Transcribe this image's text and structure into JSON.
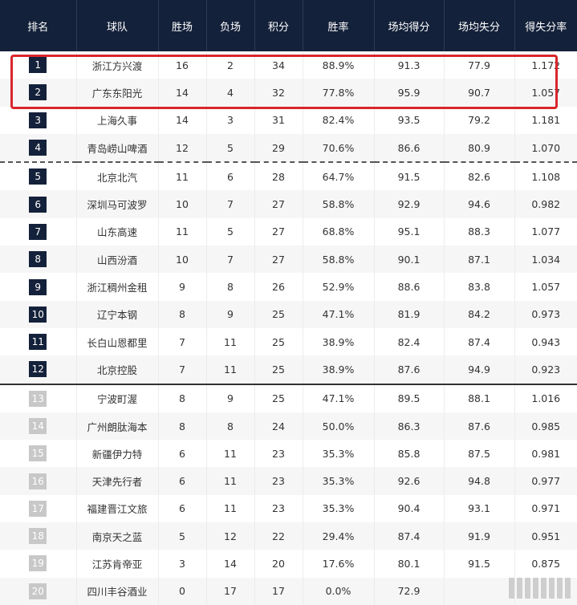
{
  "headers": [
    "排名",
    "球队",
    "胜场",
    "负场",
    "积分",
    "胜率",
    "场均得分",
    "场均失分",
    "得失分率"
  ],
  "rows": [
    {
      "rank": "1",
      "team": "浙江方兴渡",
      "wins": "16",
      "losses": "2",
      "points": "34",
      "win_pct": "88.9%",
      "ppg": "91.3",
      "opp_ppg": "77.9",
      "ratio": "1.172"
    },
    {
      "rank": "2",
      "team": "广东东阳光",
      "wins": "14",
      "losses": "4",
      "points": "32",
      "win_pct": "77.8%",
      "ppg": "95.9",
      "opp_ppg": "90.7",
      "ratio": "1.057"
    },
    {
      "rank": "3",
      "team": "上海久事",
      "wins": "14",
      "losses": "3",
      "points": "31",
      "win_pct": "82.4%",
      "ppg": "93.5",
      "opp_ppg": "79.2",
      "ratio": "1.181"
    },
    {
      "rank": "4",
      "team": "青岛崂山啤酒",
      "wins": "12",
      "losses": "5",
      "points": "29",
      "win_pct": "70.6%",
      "ppg": "86.6",
      "opp_ppg": "80.9",
      "ratio": "1.070"
    },
    {
      "rank": "5",
      "team": "北京北汽",
      "wins": "11",
      "losses": "6",
      "points": "28",
      "win_pct": "64.7%",
      "ppg": "91.5",
      "opp_ppg": "82.6",
      "ratio": "1.108"
    },
    {
      "rank": "6",
      "team": "深圳马可波罗",
      "wins": "10",
      "losses": "7",
      "points": "27",
      "win_pct": "58.8%",
      "ppg": "92.9",
      "opp_ppg": "94.6",
      "ratio": "0.982"
    },
    {
      "rank": "7",
      "team": "山东高速",
      "wins": "11",
      "losses": "5",
      "points": "27",
      "win_pct": "68.8%",
      "ppg": "95.1",
      "opp_ppg": "88.3",
      "ratio": "1.077"
    },
    {
      "rank": "8",
      "team": "山西汾酒",
      "wins": "10",
      "losses": "7",
      "points": "27",
      "win_pct": "58.8%",
      "ppg": "90.1",
      "opp_ppg": "87.1",
      "ratio": "1.034"
    },
    {
      "rank": "9",
      "team": "浙江稠州金租",
      "wins": "9",
      "losses": "8",
      "points": "26",
      "win_pct": "52.9%",
      "ppg": "88.6",
      "opp_ppg": "83.8",
      "ratio": "1.057"
    },
    {
      "rank": "10",
      "team": "辽宁本钢",
      "wins": "8",
      "losses": "9",
      "points": "25",
      "win_pct": "47.1%",
      "ppg": "81.9",
      "opp_ppg": "84.2",
      "ratio": "0.973"
    },
    {
      "rank": "11",
      "team": "长白山恩都里",
      "wins": "7",
      "losses": "11",
      "points": "25",
      "win_pct": "38.9%",
      "ppg": "82.4",
      "opp_ppg": "87.4",
      "ratio": "0.943"
    },
    {
      "rank": "12",
      "team": "北京控股",
      "wins": "7",
      "losses": "11",
      "points": "25",
      "win_pct": "38.9%",
      "ppg": "87.6",
      "opp_ppg": "94.9",
      "ratio": "0.923"
    },
    {
      "rank": "13",
      "team": "宁波町渥",
      "wins": "8",
      "losses": "9",
      "points": "25",
      "win_pct": "47.1%",
      "ppg": "89.5",
      "opp_ppg": "88.1",
      "ratio": "1.016"
    },
    {
      "rank": "14",
      "team": "广州朗肽海本",
      "wins": "8",
      "losses": "8",
      "points": "24",
      "win_pct": "50.0%",
      "ppg": "86.3",
      "opp_ppg": "87.6",
      "ratio": "0.985"
    },
    {
      "rank": "15",
      "team": "新疆伊力特",
      "wins": "6",
      "losses": "11",
      "points": "23",
      "win_pct": "35.3%",
      "ppg": "85.8",
      "opp_ppg": "87.5",
      "ratio": "0.981"
    },
    {
      "rank": "16",
      "team": "天津先行者",
      "wins": "6",
      "losses": "11",
      "points": "23",
      "win_pct": "35.3%",
      "ppg": "92.6",
      "opp_ppg": "94.8",
      "ratio": "0.977"
    },
    {
      "rank": "17",
      "team": "福建晋江文旅",
      "wins": "6",
      "losses": "11",
      "points": "23",
      "win_pct": "35.3%",
      "ppg": "90.4",
      "opp_ppg": "93.1",
      "ratio": "0.971"
    },
    {
      "rank": "18",
      "team": "南京天之蓝",
      "wins": "5",
      "losses": "12",
      "points": "22",
      "win_pct": "29.4%",
      "ppg": "87.4",
      "opp_ppg": "91.9",
      "ratio": "0.951"
    },
    {
      "rank": "19",
      "team": "江苏肯帝亚",
      "wins": "3",
      "losses": "14",
      "points": "20",
      "win_pct": "17.6%",
      "ppg": "80.1",
      "opp_ppg": "91.5",
      "ratio": "0.875"
    },
    {
      "rank": "20",
      "team": "四川丰谷酒业",
      "wins": "0",
      "losses": "17",
      "points": "17",
      "win_pct": "0.0%",
      "ppg": "72.9",
      "opp_ppg": "",
      "ratio": ""
    }
  ],
  "colors": {
    "header_bg": "#14213a",
    "rank_badge_top": "#14213a",
    "rank_badge_lower": "#c8c8c8",
    "highlight_border": "#d9262c"
  }
}
